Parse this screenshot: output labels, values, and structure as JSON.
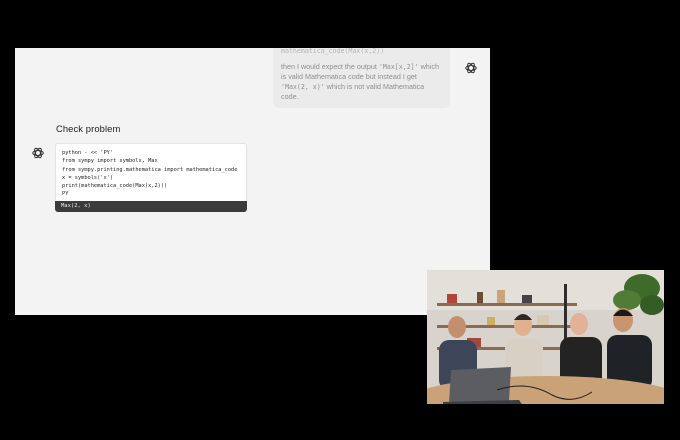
{
  "prompt_bubble": {
    "top_line": "mathematica_code(Max(x,2))",
    "text_1": "then I would expect the output ",
    "code_1": "'Max[x,2]'",
    "text_2": " which is valid Mathematica code but instead I get ",
    "code_2": "'Max(2, x)'",
    "text_3": " which is not valid Mathematica code."
  },
  "section_title": "Check problem",
  "code_block": {
    "lines": [
      "python - << 'PY'",
      "from sympy import symbols, Max",
      "from sympy.printing.mathematica import mathematica_code",
      "x = symbols('x')",
      "print(mathematica_code(Max(x,2)))",
      "PY"
    ],
    "output": "Max(2, x)"
  },
  "icons": {
    "assistant_logo": "openai-logo-icon",
    "user_logo": "openai-logo-icon"
  },
  "colors": {
    "screen_bg": "#f3f3f3",
    "bubble_bg": "#ebebeb",
    "output_bar": "#3b3b3b"
  }
}
